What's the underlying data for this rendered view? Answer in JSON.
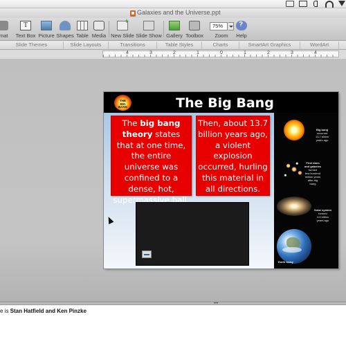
{
  "window": {
    "title": "Galaxies and the Universe.ppt"
  },
  "toolbar": {
    "format_label": "rmat",
    "textbox_label": "Text Box",
    "picture_label": "Picture",
    "shapes_label": "Shapes",
    "table_label": "Table",
    "media_label": "Media",
    "new_slide_label": "New Slide",
    "slide_show_label": "Slide Show",
    "gallery_label": "Gallery",
    "toolbox_label": "Toolbox",
    "zoom_value": "75%",
    "zoom_label": "Zoom",
    "help_label": "Help"
  },
  "ribbon": {
    "tabs": [
      "Slide Themes",
      "Slide Layouts",
      "Transitions",
      "Table Styles",
      "Charts",
      "SmartArt Graphics",
      "WordArt"
    ]
  },
  "ruler": {
    "labels": [
      "4",
      "3",
      "2",
      "1",
      "0",
      "1",
      "2",
      "3",
      "4"
    ]
  },
  "slide": {
    "logo_line1": "THE",
    "logo_line2": "BIG",
    "logo_line3": "BANG",
    "title": "The Big Bang",
    "box1_pre": "The ",
    "box1_bold1": "big bang",
    "box1_bold2": "theory",
    "box1_post": " states that at one time, the entire universe was confined to a dense, hot, supermassive ball.",
    "box2": "Then, about 13.7 billion years ago, a violent explosion occurred, hurling this material in all directions.",
    "panel": {
      "label1_title": "Big bang",
      "label1_sub1": "occurred",
      "label1_sub2": "13.7 billion",
      "label1_sub3": "years ago",
      "label2_title1": "First stars",
      "label2_title2": "and galaxies",
      "label2_sub1": "formed",
      "label2_sub2": "few hundred",
      "label2_sub3": "million years",
      "label2_sub4": "after big",
      "label2_sub5": "bang",
      "label3_title": "Solar system",
      "label3_sub1": "formed",
      "label3_sub2": "4.6 billion",
      "label3_sub3": "years ago",
      "label4_title": "Earth today"
    }
  },
  "notes": {
    "pre": "e is ",
    "bold": "Stan Hatfield and Ken Pinzke"
  }
}
